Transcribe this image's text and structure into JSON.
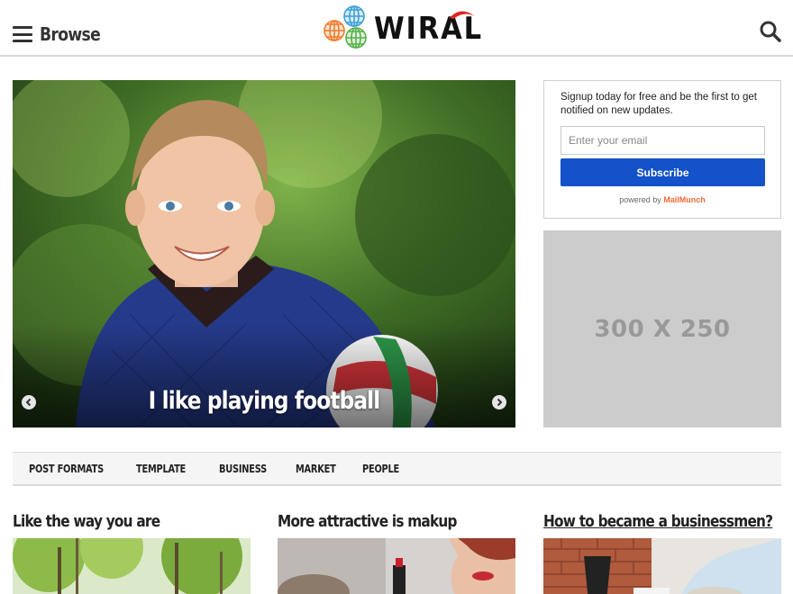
{
  "header": {
    "browse_label": "Browse",
    "logo_text": "WIRAL",
    "menu_icon": "hamburger-menu-icon",
    "search_icon": "search-icon"
  },
  "slider": {
    "caption": "I like playing football",
    "prev_icon": "chevron-left-icon",
    "next_icon": "chevron-right-icon"
  },
  "signup": {
    "message": "Signup today for free and be the first to get notified on new updates.",
    "email_placeholder": "Enter your email",
    "subscribe_label": "Subscribe",
    "powered_prefix": "powered by",
    "powered_brand": "MailMunch",
    "button_color": "#1352c8",
    "brand_color": "#f26b38"
  },
  "ad": {
    "label": "300 X 250"
  },
  "categories": [
    {
      "label": "POST FORMATS"
    },
    {
      "label": "TEMPLATE"
    },
    {
      "label": "BUSINESS"
    },
    {
      "label": "MARKET"
    },
    {
      "label": "PEOPLE"
    }
  ],
  "posts": [
    {
      "title": "Like the way you are"
    },
    {
      "title": "More attractive is makup"
    },
    {
      "title": "How to became a businessmen?"
    }
  ]
}
